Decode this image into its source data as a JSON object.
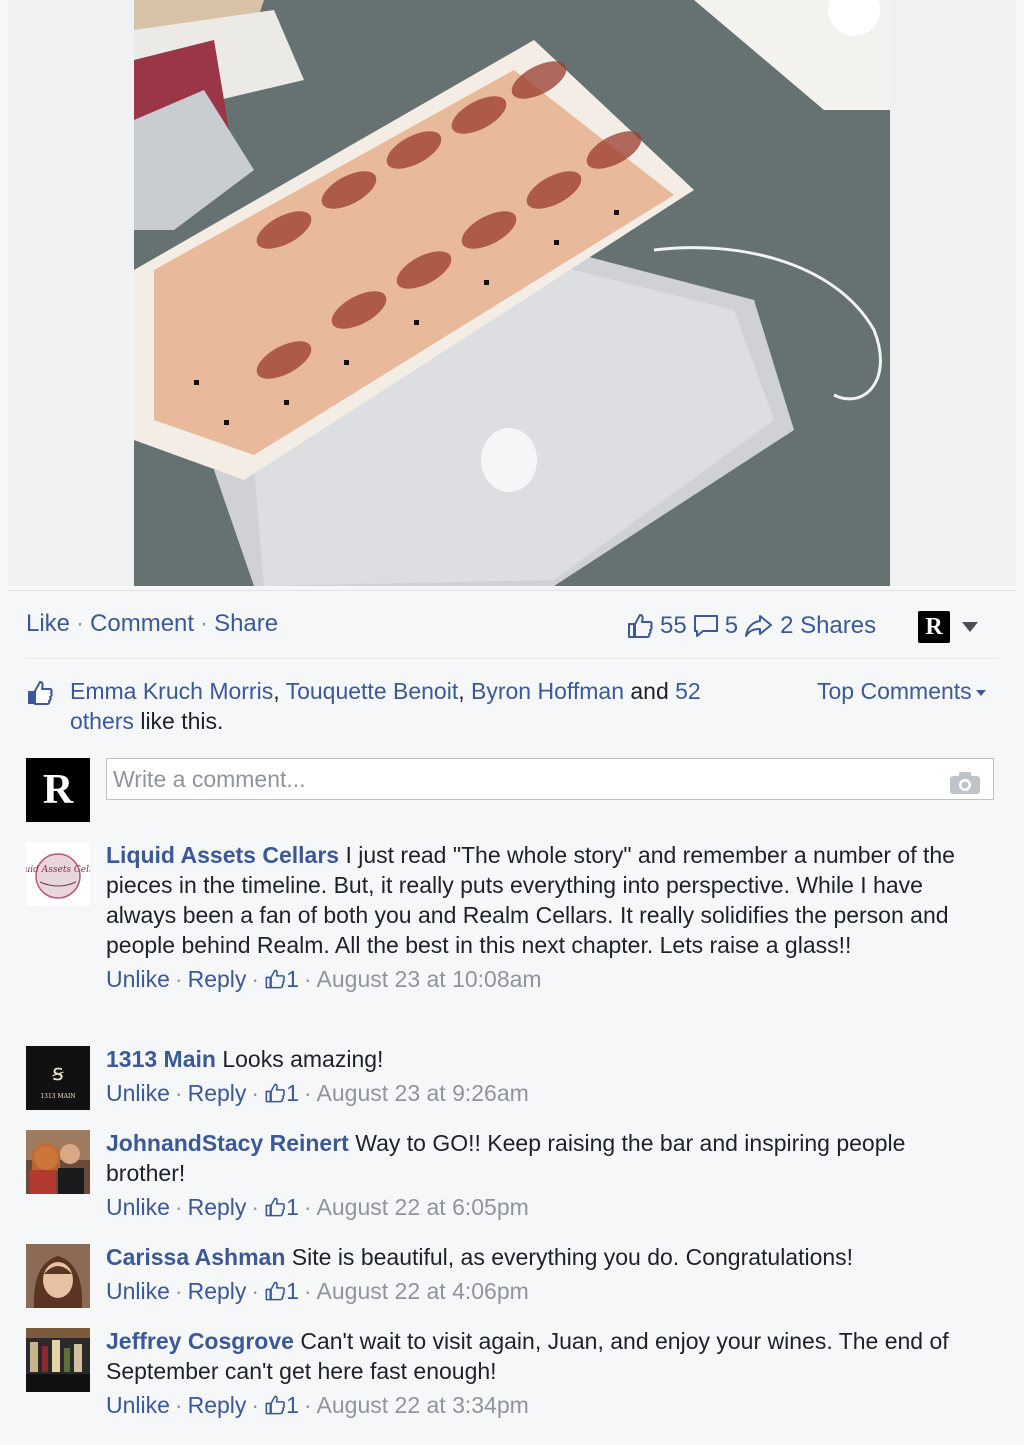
{
  "post": {
    "actions": {
      "like": "Like",
      "comment": "Comment",
      "share": "Share"
    },
    "stats": {
      "likes": "55",
      "comments": "5",
      "shares": "2 Shares"
    },
    "page_badge": "R",
    "likes_summary": {
      "names": [
        "Emma Kruch Morris",
        "Touquette Benoit",
        "Byron Hoffman"
      ],
      "and": "and",
      "others_count": "52",
      "others_word": "others",
      "tail": "like this."
    },
    "sort_label": "Top Comments",
    "composer_placeholder": "Write a comment..."
  },
  "comments": [
    {
      "author": "Liquid Assets Cellars",
      "text": "I just read \"The whole story\" and remember a number of the pieces in the timeline. But, it really puts everything into perspective. While I have always been a fan of both you and Realm Cellars. It really solidifies the person and people behind Realm. All the best in this next chapter. Lets raise a glass!!",
      "unlike": "Unlike",
      "reply": "Reply",
      "likes": "1",
      "time": "August 23 at 10:08am",
      "avatar_text": "Liquid Assets Cellars"
    },
    {
      "author": "1313 Main",
      "text": "Looks amazing!",
      "unlike": "Unlike",
      "reply": "Reply",
      "likes": "1",
      "time": "August 23 at 9:26am",
      "avatar_text": "1313 MAIN"
    },
    {
      "author": "JohnandStacy Reinert",
      "text": "Way to GO!! Keep raising the bar and inspiring people brother!",
      "unlike": "Unlike",
      "reply": "Reply",
      "likes": "1",
      "time": "August 22 at 6:05pm"
    },
    {
      "author": "Carissa Ashman",
      "text": "Site is beautiful, as everything you do. Congratulations!",
      "unlike": "Unlike",
      "reply": "Reply",
      "likes": "1",
      "time": "August 22 at 4:06pm"
    },
    {
      "author": "Jeffrey Cosgrove",
      "text": "Can't wait to visit again, Juan, and enjoy your wines. The end of September can't get here fast enough!",
      "unlike": "Unlike",
      "reply": "Reply",
      "likes": "1",
      "time": "August 22 at 3:34pm"
    }
  ],
  "colors": {
    "link": "#3b5998",
    "meta": "#90949c",
    "background": "#f6f7f9"
  },
  "icons": [
    "like-thumb-icon",
    "comment-bubble-icon",
    "share-arrow-icon",
    "camera-icon",
    "caret-down-icon"
  ]
}
